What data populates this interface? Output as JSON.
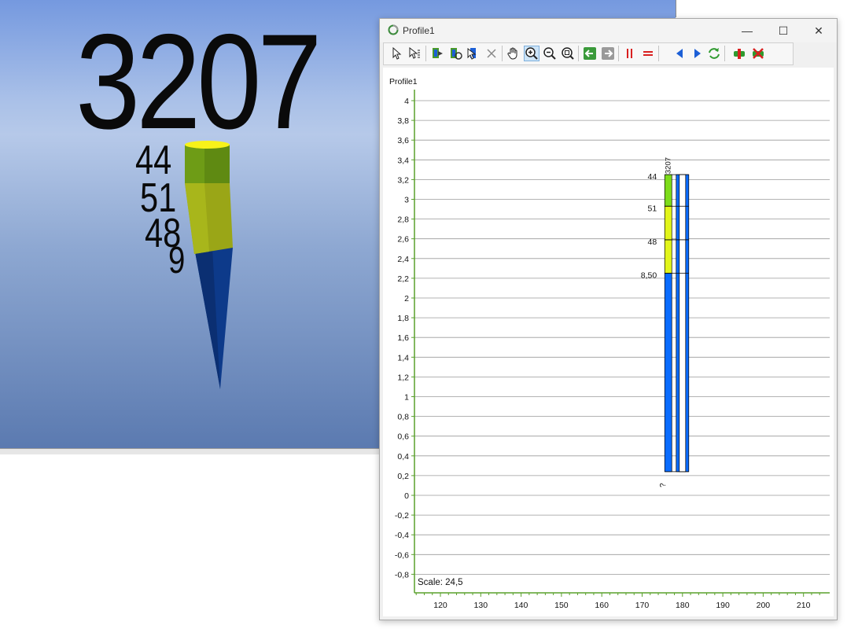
{
  "scene": {
    "big_label": "3207",
    "side_labels": [
      "44",
      "51",
      "48",
      "9"
    ]
  },
  "window": {
    "title": "Profile1",
    "minimize": "—",
    "maximize": "☐",
    "close": "✕"
  },
  "toolbar": {
    "icons": [
      "select-arrow-icon",
      "select-edit-icon",
      "borehole-add-icon",
      "borehole-refresh-icon",
      "borehole-select-icon",
      "delete-x-icon",
      "pan-hand-icon",
      "zoom-in-icon",
      "zoom-out-icon",
      "zoom-extent-icon",
      "arrow-left-icon",
      "arrow-right-icon",
      "vertical-lines-icon",
      "horizontal-lines-icon",
      "triangle-left-icon",
      "triangle-right-icon",
      "sync-arrows-icon",
      "connect-icon",
      "disconnect-icon"
    ],
    "active": "zoom-in-icon"
  },
  "colors": {
    "axis": "#5aa02c",
    "grid": "#9a9a9a",
    "column_blue": "#0a6cff",
    "layer_green": "#7ddc1a",
    "layer_yellow": "#e2f51a"
  },
  "profile": {
    "title": "Profile1",
    "scale_text": "Scale: 24,5",
    "y_ticks": [
      "4",
      "3,8",
      "3,6",
      "3,4",
      "3,2",
      "3",
      "2,8",
      "2,6",
      "2,4",
      "2,2",
      "2",
      "1,8",
      "1,6",
      "1,4",
      "1,2",
      "1",
      "0,8",
      "0,6",
      "0,4",
      "0,2",
      "0",
      "-0,2",
      "-0,4",
      "-0,6",
      "-0,8"
    ],
    "x_ticks": [
      "120",
      "130",
      "140",
      "150",
      "160",
      "170",
      "180",
      "190",
      "200",
      "210"
    ],
    "borehole": {
      "name": "3207",
      "bottom_label": "?",
      "top": 3.25,
      "bottom": 0.24,
      "left_x": 175.6,
      "right_x": 180,
      "layers": [
        {
          "label": "44",
          "from": 3.25,
          "to": 2.93,
          "color": "green"
        },
        {
          "label": "51",
          "from": 2.93,
          "to": 2.59,
          "color": "yellow"
        },
        {
          "label": "48",
          "from": 2.59,
          "to": 2.25,
          "color": "yellow"
        },
        {
          "label": "8,50",
          "from": 2.25,
          "to": 0.24,
          "color": "blue"
        }
      ]
    }
  }
}
